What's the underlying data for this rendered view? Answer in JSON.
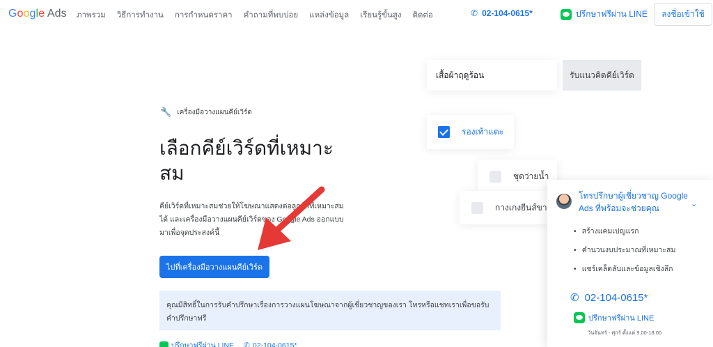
{
  "header": {
    "logo_google": "Google",
    "logo_ads": "Ads",
    "nav": [
      "ภาพรวม",
      "วิธีการทำงาน",
      "การกำหนดราคา",
      "คำถามที่พบบ่อย",
      "แหล่งข้อมูล",
      "เรียนรู้ขั้นสูง",
      "ติดต่อ"
    ],
    "phone": "02-104-0615*",
    "line_label": "ปรึกษาฟรีผ่าน LINE",
    "signin": "ลงชื่อเข้าใช้"
  },
  "hero": {
    "tool_label": "เครื่องมือวางแผนคีย์เวิร์ด",
    "headline": "เลือกคีย์เวิร์ดที่เหมาะสม",
    "description": "คีย์เวิร์ดที่เหมาะสมช่วยให้โฆษณาแสดงต่อลูกค้าที่เหมาะสม ได้ และเครื่องมือวางแผนคีย์เวิร์ดของ Google Ads ออกแบบมาเพื่อจุดประสงค์นี้",
    "cta": "ไปที่เครื่องมือวางแผนคีย์เวิร์ด",
    "notice": "คุณมีสิทธิ์ในการรับคำปรึกษาเรื่องการวางแผนโฆษณาจากผู้เชี่ยวชาญของเรา โทรหรือแชทเราเพื่อขอรับคำปรึกษาฟรี",
    "bottom_line": "ปรึกษาฟรีผ่าน LINE",
    "bottom_phone": "02-104-0615*"
  },
  "illustration": {
    "keyword_input": "เสื้อผ้าฤดูร้อน",
    "keyword_button": "รับแนวคิดคีย์เวิร์ด",
    "options": [
      {
        "label": "รองเท้าแตะ",
        "checked": true
      },
      {
        "label": "ชุดว่ายน้ำ",
        "checked": false
      },
      {
        "label": "กางเกงยีนส์ขา",
        "checked": false
      }
    ]
  },
  "consult_panel": {
    "title": "โทรปรึกษาผู้เชี่ยวชาญ Google Ads ที่พร้อมจะช่วยคุณ",
    "bullets": [
      "สร้างแคมเปญแรก",
      "คำนวนงบประมาณที่เหมาะสม",
      "แชร์เคล็ดลับและข้อมูลเชิงลึก"
    ],
    "phone": "02-104-0615*",
    "line_label": "ปรึกษาฟรีผ่าน LINE",
    "hours": "วันจันทร์ - ศุกร์ ตั้งแต่ 9.00-18.00"
  },
  "colors": {
    "brand_blue": "#1a73e8",
    "line_green": "#06c755",
    "arrow_red": "#e53935",
    "notice_bg": "#e8f0fe"
  }
}
